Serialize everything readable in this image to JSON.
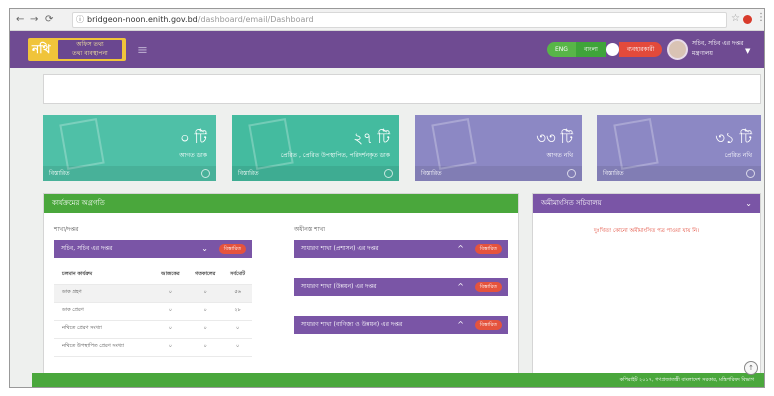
{
  "browser": {
    "back_icon": "arrow-left-icon",
    "forward_icon": "arrow-right-icon",
    "reload_icon": "reload-icon",
    "url_host": "bridgeon-noon.enith.gov.bd",
    "url_path": "/dashboard/email/Dashboard",
    "star_icon": "star-icon",
    "menu_icon": "kebab-icon"
  },
  "header": {
    "logo_mark": "নথি",
    "logo_line1": "অফিস তথ্য",
    "logo_line2": "তথ্য ব্যবস্থাপনা",
    "menu_icon": "hamburger-icon",
    "lang_option_1": "ENG",
    "lang_option_2": "বাংলা",
    "lang_option_3": "ব্যবহারকারী",
    "user_name": "সচিব, সচিব এর দপ্তর",
    "user_org": "মন্ত্রণালয়",
    "brand_color": "#6f4b92"
  },
  "cards": [
    {
      "value": "০ টি",
      "label": "আগত ডাক",
      "footer": "বিস্তারিত",
      "color": "#4fc0a7"
    },
    {
      "value": "২৭ টি",
      "label": "প্রেরিত , প্রেরিত উপস্থাপিত, পরিদর্শনকৃত ডাক",
      "footer": "বিস্তারিত",
      "color": "#44bb9f"
    },
    {
      "value": "৩৩ টি",
      "label": "আগত নথি",
      "footer": "বিস্তারিত",
      "color": "#8c88c4"
    },
    {
      "value": "৩১ টি",
      "label": "প্রেরিত নথি",
      "footer": "বিস্তারিত",
      "color": "#8c88c4"
    }
  ],
  "main_panel": {
    "title": "কার্যক্রমের অগ্রগতি",
    "left_section_title": "শাখা/দপ্তর",
    "left_bar_label": "সচিব, সচিব এর দপ্তর",
    "left_bar_button": "বিস্তারিত",
    "table": {
      "headers": [
        "চলমান কার্যক্রম",
        "আজকের",
        "গতকালের",
        "সর্বমোট"
      ],
      "rows": [
        [
          "ডাক গ্রহণ",
          "০",
          "০",
          "৫৬"
        ],
        [
          "ডাক প্রেরণ",
          "০",
          "০",
          "২৮"
        ],
        [
          "নথিতে প্রেরণ সংখ্যা",
          "০",
          "০",
          "০"
        ],
        [
          "নথিতে উপস্থাপিত প্রেরণ সংখ্যা",
          "০",
          "০",
          "০"
        ]
      ]
    },
    "right_section_title": "অধীনস্ত শাখা",
    "sub_bars": [
      {
        "label": "সাধারণ শাখা (প্রশাসন) এর দপ্তর",
        "button": "বিস্তারিত"
      },
      {
        "label": "সাধারণ শাখা (উন্নয়ন) এর দপ্তর",
        "button": "বিস্তারিত"
      },
      {
        "label": "সাধারণ শাখা (বাণিজ্য ও উন্নয়ন) এর দপ্তর",
        "button": "বিস্তারিত"
      }
    ]
  },
  "right_panel": {
    "title": "অমীমাংসিত সচিবালয়",
    "message": "দুঃখিত! কোনো অমীমাংসিত পত্র পাওয়া যায় নি।"
  },
  "footer": {
    "text": "কপিরাইট ২০১৭, গণপ্রজাতন্ত্রী বাংলাদেশ সরকার, মন্ত্রিপরিষদ বিভাগ"
  }
}
